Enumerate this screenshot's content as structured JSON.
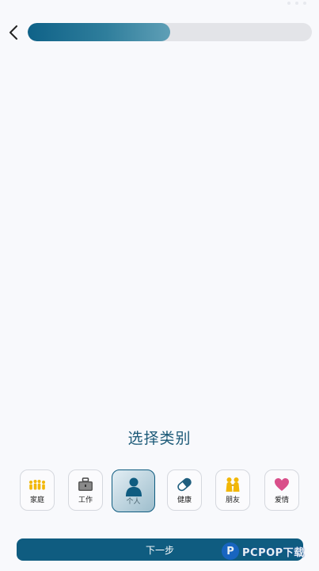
{
  "header": {
    "back_icon": "chevron-left-icon",
    "progress_fraction": 0.5
  },
  "prompt": {
    "text": "选择类别"
  },
  "categories": [
    {
      "label": "家庭",
      "icon": "family-icon",
      "color": "#f2b705",
      "selected": false
    },
    {
      "label": "工作",
      "icon": "briefcase-icon",
      "color": "#444444",
      "selected": false
    },
    {
      "label": "个人",
      "icon": "person-icon",
      "color": "#0f5c80",
      "selected": true
    },
    {
      "label": "健康",
      "icon": "pill-icon",
      "color": "#1f5e7e",
      "selected": false
    },
    {
      "label": "朋友",
      "icon": "friends-icon",
      "color": "#f2b705",
      "selected": false
    },
    {
      "label": "爱情",
      "icon": "heart-icon",
      "color": "#d94f8a",
      "selected": false
    }
  ],
  "footer": {
    "next_label": "下一步"
  },
  "watermark": {
    "text": "PCPOP下载",
    "logo_letter": "P"
  },
  "colors": {
    "accent": "#0f5c80",
    "background": "#f8f9fc",
    "progress_track": "#e3e4e8"
  }
}
